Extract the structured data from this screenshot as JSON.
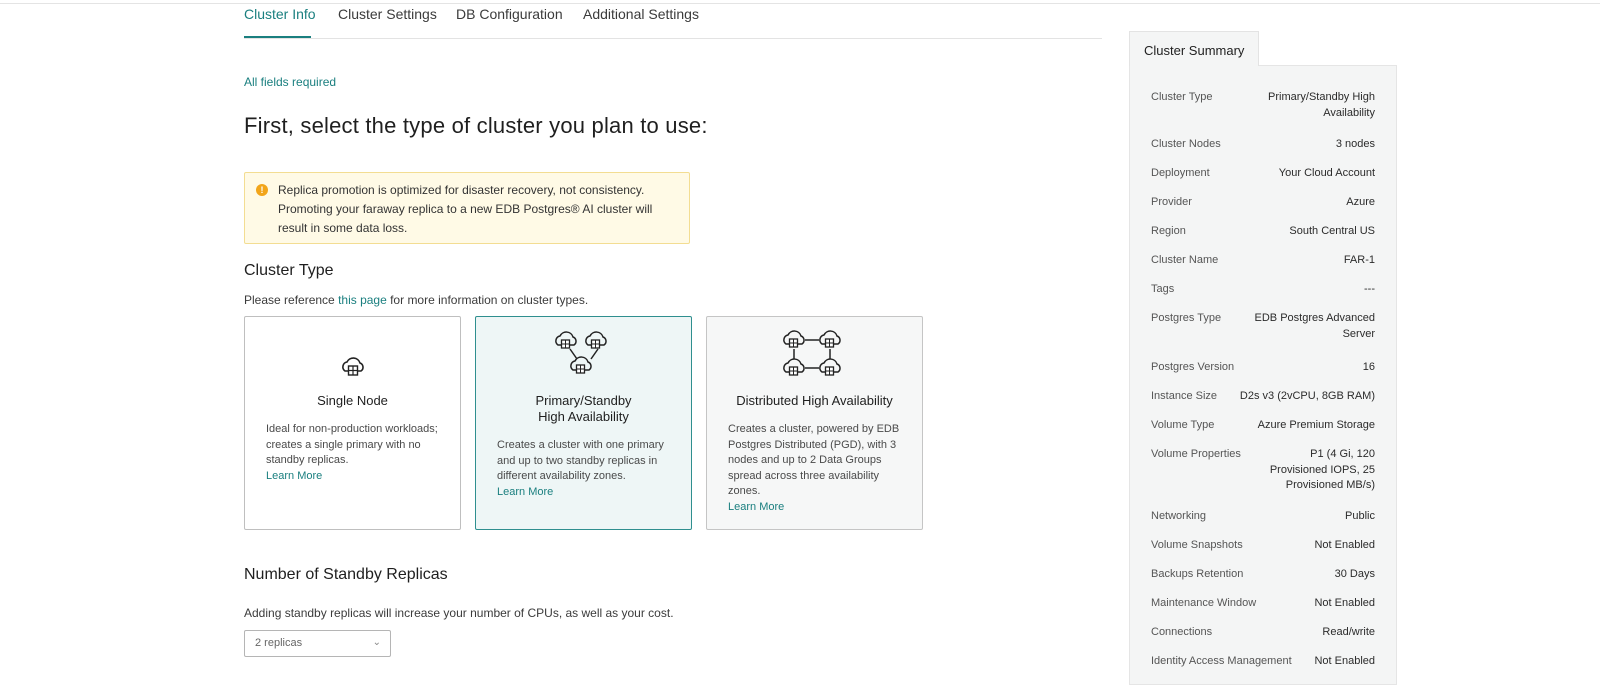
{
  "tabs": [
    {
      "label": "Cluster Info",
      "active": true
    },
    {
      "label": "Cluster Settings",
      "active": false
    },
    {
      "label": "DB Configuration",
      "active": false
    },
    {
      "label": "Additional Settings",
      "active": false
    }
  ],
  "all_fields_required": "All fields required",
  "heading": "First, select the type of cluster you plan to use:",
  "warning": {
    "icon": "warning-icon",
    "text": "Replica promotion is optimized for disaster recovery, not consistency. Promoting your faraway replica to a new EDB Postgres® AI cluster will result in some data loss."
  },
  "cluster_type": {
    "title": "Cluster Type",
    "reference_prefix": "Please reference ",
    "reference_link": "this page",
    "reference_suffix": " for more information on cluster types.",
    "cards": [
      {
        "icon": "single-node-icon",
        "title": "Single Node",
        "description": "Ideal for non-production workloads; creates a single primary with no standby replicas.",
        "link": "Learn More",
        "selected": false
      },
      {
        "icon": "primary-standby-icon",
        "title_line1": "Primary/Standby",
        "title_line2": "High Availability",
        "description": "Creates a cluster with one primary and up to two standby replicas in different availability zones.",
        "link": "Learn More",
        "selected": true
      },
      {
        "icon": "distributed-ha-icon",
        "title": "Distributed High Availability",
        "description": "Creates a cluster, powered by EDB Postgres Distributed (PGD), with 3 nodes and up to 2 Data Groups spread across three availability zones.",
        "link": "Learn More",
        "selected": false
      }
    ]
  },
  "standby": {
    "title": "Number of Standby Replicas",
    "description": "Adding standby replicas will increase your number of CPUs, as well as your cost.",
    "select_value": "2 replicas"
  },
  "summary": {
    "tab_label": "Cluster Summary",
    "rows": [
      {
        "label": "Cluster Type",
        "value_lines": [
          "Primary/Standby High",
          "Availability"
        ]
      },
      {
        "label": "Cluster Nodes",
        "value_lines": [
          "3 nodes"
        ]
      },
      {
        "label": "Deployment",
        "value_lines": [
          "Your Cloud Account"
        ]
      },
      {
        "label": "Provider",
        "value_lines": [
          "Azure"
        ]
      },
      {
        "label": "Region",
        "value_lines": [
          "South Central US"
        ]
      },
      {
        "label": "Cluster Name",
        "value_lines": [
          "FAR-1"
        ]
      },
      {
        "label": "Tags",
        "value_lines": [
          "---"
        ]
      },
      {
        "label": "Postgres Type",
        "value_lines": [
          "EDB Postgres Advanced",
          "Server"
        ]
      },
      {
        "label": "Postgres Version",
        "value_lines": [
          "16"
        ]
      },
      {
        "label": "Instance Size",
        "value_lines": [
          "D2s v3 (2vCPU, 8GB RAM)"
        ]
      },
      {
        "label": "Volume Type",
        "value_lines": [
          "Azure Premium Storage"
        ]
      },
      {
        "label": "Volume Properties",
        "value_lines": [
          "P1 (4 Gi, 120",
          "Provisioned IOPS, 25",
          "Provisioned MB/s)"
        ]
      },
      {
        "label": "Networking",
        "value_lines": [
          "Public"
        ]
      },
      {
        "label": "Volume Snapshots",
        "value_lines": [
          "Not Enabled"
        ]
      },
      {
        "label": "Backups Retention",
        "value_lines": [
          "30 Days"
        ]
      },
      {
        "label": "Maintenance Window",
        "value_lines": [
          "Not Enabled"
        ]
      },
      {
        "label": "Connections",
        "value_lines": [
          "Read/write"
        ]
      },
      {
        "label": "Identity Access Management",
        "value_lines": [
          "Not Enabled"
        ]
      }
    ]
  },
  "colors": {
    "accent": "#1a7f7f",
    "warning_bg": "#fffae6",
    "warning_icon": "#f2a51a"
  }
}
